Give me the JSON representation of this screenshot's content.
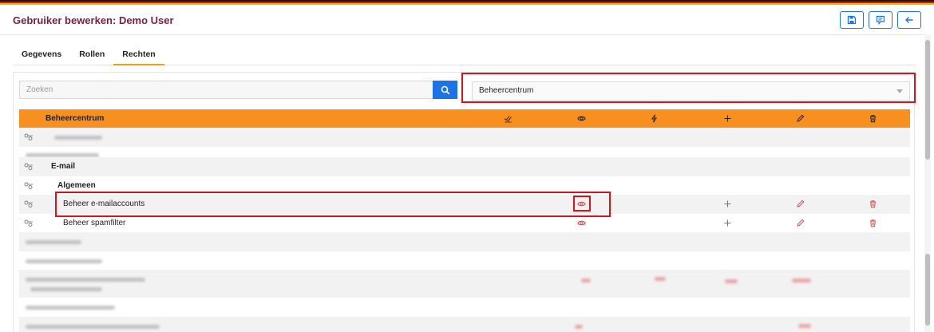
{
  "header": {
    "title": "Gebruiker bewerken: Demo User",
    "buttons": [
      {
        "name": "save-icon"
      },
      {
        "name": "message-icon"
      },
      {
        "name": "arrow-left-icon"
      }
    ]
  },
  "tabs": [
    {
      "label": "Gegevens",
      "active": false
    },
    {
      "label": "Rollen",
      "active": false
    },
    {
      "label": "Rechten",
      "active": true
    }
  ],
  "search": {
    "placeholder": "Zoeken",
    "value": ""
  },
  "module_select": {
    "value": "Beheercentrum"
  },
  "table": {
    "header": {
      "label": "Beheercentrum",
      "columns": [
        "check-double-icon",
        "eye-icon",
        "bolt-icon",
        "plus-icon",
        "pencil-icon",
        "trash-icon"
      ]
    },
    "rows": [
      {
        "label": "E-mail"
      },
      {
        "label": "Algemeen"
      },
      {
        "label": "Beheer e-mailaccounts",
        "permissions": [
          "eye-icon",
          "plus-icon",
          "pencil-icon",
          "trash-icon"
        ]
      },
      {
        "label": "Beheer spamfilter",
        "permissions": [
          "eye-icon",
          "plus-icon",
          "pencil-icon",
          "trash-icon"
        ]
      }
    ]
  },
  "colors": {
    "accent_orange": "#f7901e",
    "primary_blue": "#1a73e8",
    "title_maroon": "#7a1f3d",
    "permission_red": "#e04848",
    "highlight_red": "#e0101a"
  }
}
